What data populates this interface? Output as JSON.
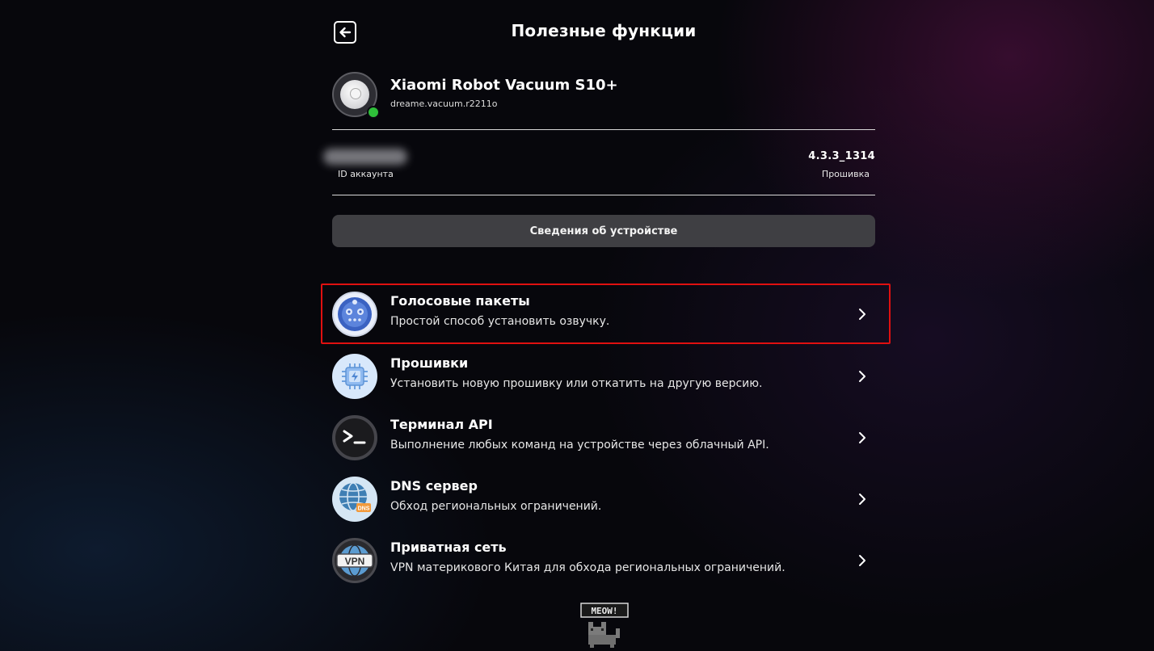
{
  "header": {
    "title": "Полезные функции",
    "back_icon": "back-arrow-icon"
  },
  "device": {
    "name": "Xiaomi Robot Vacuum S10+",
    "model": "dreame.vacuum.r2211o",
    "status_color": "#2fbf3a"
  },
  "account": {
    "id_label": "ID аккаунта"
  },
  "firmware": {
    "value": "4.3.3_1314",
    "label": "Прошивка"
  },
  "device_info_button": "Сведения об устройстве",
  "menu": [
    {
      "title": "Голосовые пакеты",
      "desc": "Простой способ установить озвучку.",
      "icon": "voice-packs-icon",
      "highlighted": true
    },
    {
      "title": "Прошивки",
      "desc": "Установить новую прошивку или откатить на другую версию.",
      "icon": "chip-icon"
    },
    {
      "title": "Терминал API",
      "desc": "Выполнение любых команд на устройстве через облачный API.",
      "icon": "terminal-icon"
    },
    {
      "title": "DNS сервер",
      "desc": "Обход региональных ограничений.",
      "icon": "dns-globe-icon"
    },
    {
      "title": "Приватная сеть",
      "desc": "VPN материкового Китая для обхода региональных ограничений.",
      "icon": "vpn-globe-icon"
    }
  ],
  "footer": {
    "mascot_text": "MEOW!"
  },
  "colors": {
    "highlight": "#e01010",
    "button_bg": "#3f3f43"
  }
}
